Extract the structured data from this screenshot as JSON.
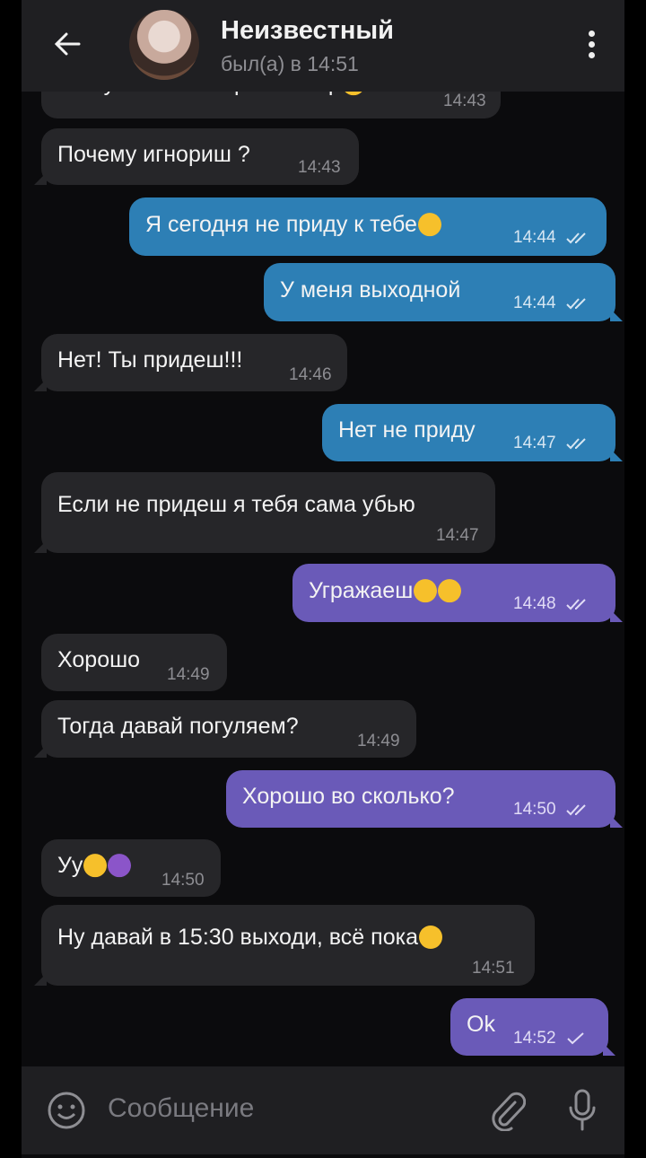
{
  "header": {
    "title": "Неизвестный",
    "status": "был(а) в 14:51"
  },
  "messages": [
    {
      "dir": "in",
      "text": "Аа ну ты же мой репетитор",
      "time": "14:43",
      "emoji": [
        "tongue-face"
      ]
    },
    {
      "dir": "in",
      "text": "Почему игнориш ?",
      "time": "14:43"
    },
    {
      "dir": "out",
      "text": "Я сегодня не приду к тебе",
      "time": "14:44",
      "emoji": [
        "relieved-face"
      ],
      "read": true
    },
    {
      "dir": "out",
      "text": "У меня выходной",
      "time": "14:44",
      "read": true
    },
    {
      "dir": "in",
      "text": "Нет! Ты придеш!!!",
      "time": "14:46"
    },
    {
      "dir": "out",
      "text": "Нет не приду",
      "time": "14:47",
      "read": true
    },
    {
      "dir": "in",
      "text": "Если не придеш я тебя сама убью",
      "time": "14:47"
    },
    {
      "dir": "out",
      "text": "Угражаеш",
      "time": "14:48",
      "emoji": [
        "smirk-face",
        "laughing-face"
      ],
      "read": true
    },
    {
      "dir": "in",
      "text": "Хорошо",
      "time": "14:49"
    },
    {
      "dir": "in",
      "text": "Тогда давай погуляем?",
      "time": "14:49"
    },
    {
      "dir": "out",
      "text": "Хорошо во сколько?",
      "time": "14:50",
      "read": true
    },
    {
      "dir": "in",
      "text": "Уу",
      "time": "14:50",
      "emoji": [
        "smile-face",
        "smiling-devil-face"
      ]
    },
    {
      "dir": "in",
      "text": "Ну давай в 15:30 выходи, всё пока",
      "time": "14:51",
      "emoji": [
        "kiss-face"
      ]
    },
    {
      "dir": "out",
      "text": "Ok",
      "time": "14:52",
      "read": false
    }
  ],
  "input": {
    "placeholder": "Сообщение"
  },
  "icons": {
    "back": "back-arrow-icon",
    "menu": "more-vertical-icon",
    "emoji": "emoji-icon",
    "attach": "paperclip-icon",
    "mic": "microphone-icon"
  },
  "colors": {
    "incoming_bubble": "#262629",
    "outgoing_bubble_blue": "#2d7fb5",
    "outgoing_bubble_violet": "#6a5ab8",
    "header": "#1f1f22",
    "background": "#0b0b0d"
  }
}
